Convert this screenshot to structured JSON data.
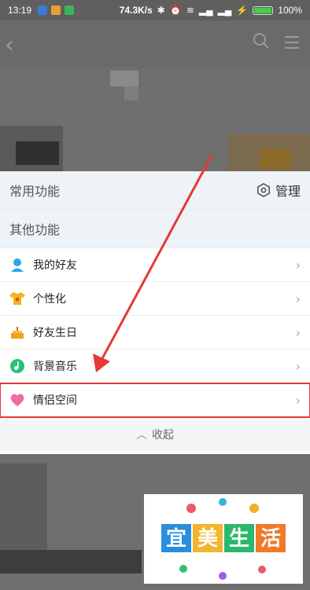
{
  "status_bar": {
    "time": "13:19",
    "network_speed": "74.3K/s",
    "battery_percent": "100%"
  },
  "menu": {
    "common_functions_label": "常用功能",
    "manage_label": "管理",
    "other_functions_label": "其他功能",
    "items": [
      {
        "label": "我的好友",
        "icon": "friend-icon"
      },
      {
        "label": "个性化",
        "icon": "shirt-icon"
      },
      {
        "label": "好友生日",
        "icon": "cake-icon"
      },
      {
        "label": "背景音乐",
        "icon": "music-icon"
      },
      {
        "label": "情侣空间",
        "icon": "heart-icon"
      }
    ],
    "collapse_label": "收起"
  },
  "watermark": {
    "text_1": "宜",
    "text_2": "美",
    "text_3": "生",
    "text_4": "活"
  },
  "colors": {
    "highlight_red": "#e53935",
    "panel_bg": "#ffffff",
    "section_bg": "#eef3f7"
  }
}
